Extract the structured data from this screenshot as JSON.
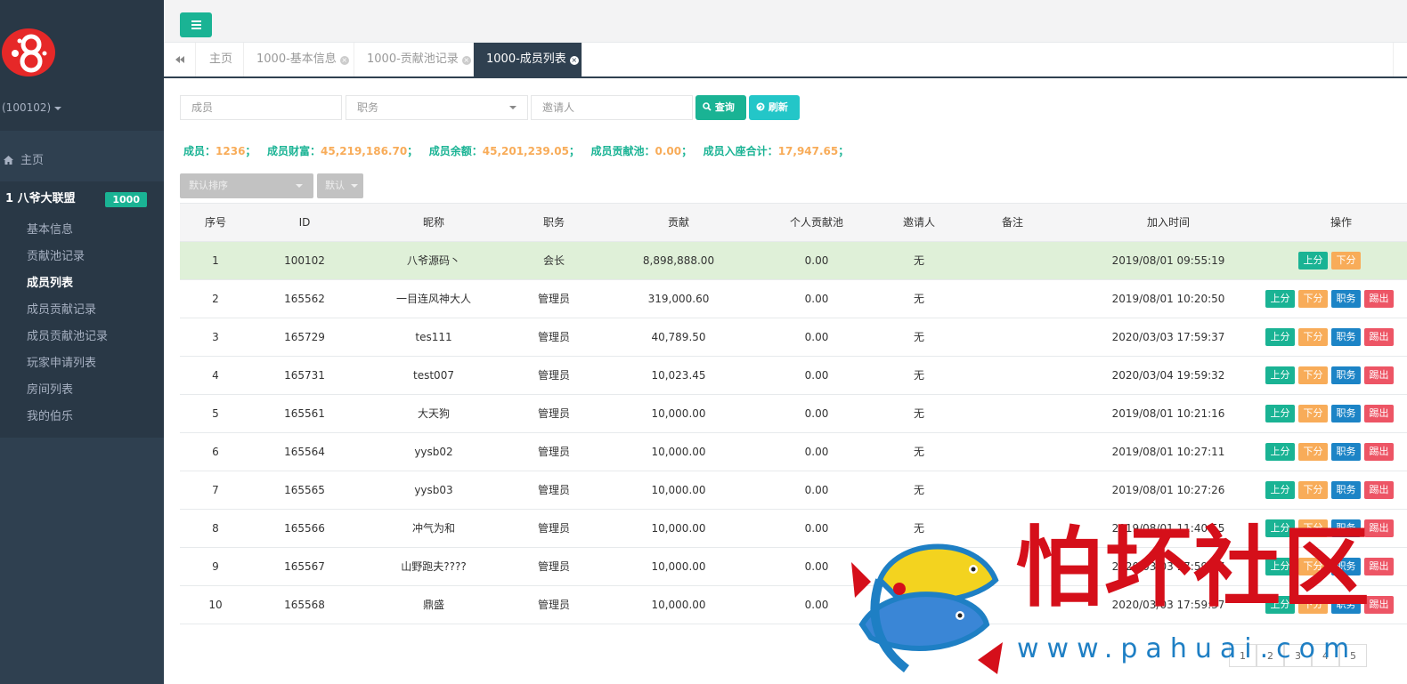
{
  "sidebar": {
    "user_id": "(100102)",
    "home_label": "主页",
    "group": {
      "title": "1  八爷大联盟",
      "badge": "1000"
    },
    "items": [
      {
        "label": "基本信息",
        "active": false
      },
      {
        "label": "贡献池记录",
        "active": false
      },
      {
        "label": "成员列表",
        "active": true
      },
      {
        "label": "成员贡献记录",
        "active": false
      },
      {
        "label": "成员贡献池记录",
        "active": false
      },
      {
        "label": "玩家申请列表",
        "active": false
      },
      {
        "label": "房间列表",
        "active": false
      },
      {
        "label": "我的伯乐",
        "active": false
      }
    ]
  },
  "tabs": [
    {
      "label": "主页",
      "closable": false
    },
    {
      "label": "1000-基本信息",
      "closable": true
    },
    {
      "label": "1000-贡献池记录",
      "closable": true
    },
    {
      "label": "1000-成员列表",
      "closable": true,
      "active": true
    }
  ],
  "filters": {
    "member_placeholder": "成员",
    "role_select": "职务",
    "inviter_placeholder": "邀请人",
    "query_label": "查询",
    "refresh_label": "刷新",
    "sort_select": "默认排序",
    "order_select": "默认"
  },
  "stats": {
    "members_label": "成员：",
    "members_value": "1236",
    "wealth_label": "成员财富：",
    "wealth_value": "45,219,186.70",
    "balance_label": "成员余额：",
    "balance_value": "45,201,239.05",
    "pool_label": "成员贡献池：",
    "pool_value": "0.00",
    "seat_label": "成员入座合计：",
    "seat_value": "17,947.65",
    "sep": "；"
  },
  "table": {
    "columns": [
      "序号",
      "ID",
      "昵称",
      "职务",
      "贡献",
      "个人贡献池",
      "邀请人",
      "备注",
      "加入时间",
      "操作"
    ],
    "op_labels": {
      "up": "上分",
      "down": "下分",
      "role": "职务",
      "kick": "踢出"
    },
    "rows": [
      {
        "no": "1",
        "id": "100102",
        "nick": "八爷源码丶",
        "role": "会长",
        "contrib": "8,898,888.00",
        "pool": "0.00",
        "inviter": "无",
        "note": "",
        "joined": "2019/08/01 09:55:19",
        "ops": [
          "up",
          "down"
        ]
      },
      {
        "no": "2",
        "id": "165562",
        "nick": "一目连风神大人",
        "role": "管理员",
        "contrib": "319,000.60",
        "pool": "0.00",
        "inviter": "无",
        "note": "",
        "joined": "2019/08/01 10:20:50",
        "ops": [
          "up",
          "down",
          "role",
          "kick"
        ]
      },
      {
        "no": "3",
        "id": "165729",
        "nick": "tes111",
        "role": "管理员",
        "contrib": "40,789.50",
        "pool": "0.00",
        "inviter": "无",
        "note": "",
        "joined": "2020/03/03 17:59:37",
        "ops": [
          "up",
          "down",
          "role",
          "kick"
        ]
      },
      {
        "no": "4",
        "id": "165731",
        "nick": "test007",
        "role": "管理员",
        "contrib": "10,023.45",
        "pool": "0.00",
        "inviter": "无",
        "note": "",
        "joined": "2020/03/04 19:59:32",
        "ops": [
          "up",
          "down",
          "role",
          "kick"
        ]
      },
      {
        "no": "5",
        "id": "165561",
        "nick": "大天狗",
        "role": "管理员",
        "contrib": "10,000.00",
        "pool": "0.00",
        "inviter": "无",
        "note": "",
        "joined": "2019/08/01 10:21:16",
        "ops": [
          "up",
          "down",
          "role",
          "kick"
        ]
      },
      {
        "no": "6",
        "id": "165564",
        "nick": "yysb02",
        "role": "管理员",
        "contrib": "10,000.00",
        "pool": "0.00",
        "inviter": "无",
        "note": "",
        "joined": "2019/08/01 10:27:11",
        "ops": [
          "up",
          "down",
          "role",
          "kick"
        ]
      },
      {
        "no": "7",
        "id": "165565",
        "nick": "yysb03",
        "role": "管理员",
        "contrib": "10,000.00",
        "pool": "0.00",
        "inviter": "无",
        "note": "",
        "joined": "2019/08/01 10:27:26",
        "ops": [
          "up",
          "down",
          "role",
          "kick"
        ]
      },
      {
        "no": "8",
        "id": "165566",
        "nick": "冲气为和",
        "role": "管理员",
        "contrib": "10,000.00",
        "pool": "0.00",
        "inviter": "无",
        "note": "",
        "joined": "2019/08/01 11:40:55",
        "ops": [
          "up",
          "down",
          "role",
          "kick"
        ]
      },
      {
        "no": "9",
        "id": "165567",
        "nick": "山野跑夫????",
        "role": "管理员",
        "contrib": "10,000.00",
        "pool": "0.00",
        "inviter": "",
        "note": "",
        "joined": "2020/03/03 17:59:37",
        "ops": [
          "up",
          "down",
          "role",
          "kick"
        ]
      },
      {
        "no": "10",
        "id": "165568",
        "nick": "鼎盛",
        "role": "管理员",
        "contrib": "10,000.00",
        "pool": "0.00",
        "inviter": "",
        "note": "",
        "joined": "2020/03/03 17:59:37",
        "ops": [
          "up",
          "down",
          "role",
          "kick"
        ]
      }
    ]
  },
  "pagination": {
    "pages": [
      "1",
      "2",
      "3",
      "4",
      "5"
    ]
  },
  "watermark": {
    "title": "怕坏社区",
    "url": "www.pahuai.com"
  },
  "colors": {
    "sidebar": "#2f4050",
    "primary": "#1ab394",
    "info": "#23c6c8",
    "warning": "#f8ac59",
    "role": "#1c84c6",
    "danger": "#ed5565",
    "highlight_row": "#dff0d8",
    "watermark_red": "#d50f1a",
    "watermark_blue": "#1e7fc4"
  },
  "icons": {
    "menu": "hamburger-icon",
    "home": "home-icon",
    "back": "double-chevron-left-icon",
    "close": "close-circle-icon",
    "search": "search-icon",
    "refresh": "refresh-icon"
  }
}
